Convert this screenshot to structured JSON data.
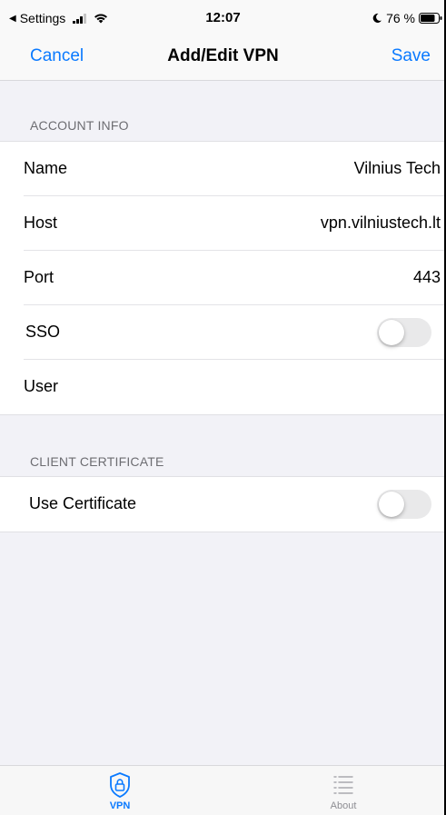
{
  "status_bar": {
    "back_label": "Settings",
    "time": "12:07",
    "battery": "76 %"
  },
  "nav": {
    "cancel_label": "Cancel",
    "title": "Add/Edit VPN",
    "save_label": "Save"
  },
  "sections": {
    "account_info": {
      "header": "ACCOUNT INFO",
      "rows": [
        {
          "label": "Name",
          "value": "Vilnius Tech"
        },
        {
          "label": "Host",
          "value": "vpn.vilniustech.lt"
        },
        {
          "label": "Port",
          "value": "443"
        },
        {
          "label": "SSO",
          "toggle": false
        },
        {
          "label": "User",
          "value": ""
        }
      ]
    },
    "client_certificate": {
      "header": "CLIENT CERTIFICATE",
      "rows": [
        {
          "label": "Use Certificate",
          "toggle": false
        }
      ]
    }
  },
  "tabs": [
    {
      "label": "VPN",
      "icon": "lock-shield-icon",
      "active": true
    },
    {
      "label": "About",
      "icon": "list-icon",
      "active": false
    }
  ],
  "colors": {
    "accent": "#0a7aff",
    "background": "#f2f2f7",
    "toggle_off": "#e9e9ea"
  }
}
